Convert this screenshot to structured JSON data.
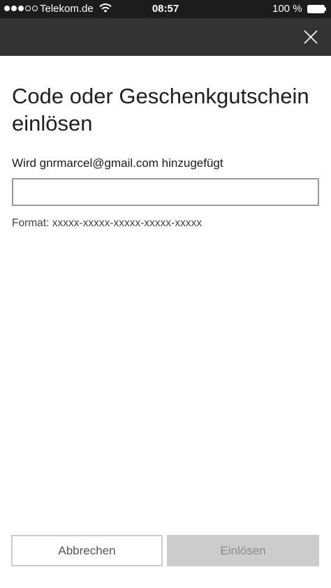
{
  "status_bar": {
    "carrier": "Telekom.de",
    "time": "08:57",
    "battery": "100 %",
    "signal_bars_filled": 3,
    "signal_bars_total": 5
  },
  "header": {
    "close_icon": "close-icon"
  },
  "main": {
    "title": "Code oder Geschenkgutschein einlösen",
    "account_label": "Wird gnrmarcel@gmail.com hinzugefügt",
    "code_input": {
      "value": "",
      "placeholder": ""
    },
    "format_hint": "Format: xxxxx-xxxxx-xxxxx-xxxxx-xxxxx"
  },
  "footer": {
    "cancel_label": "Abbrechen",
    "redeem_label": "Einlösen"
  },
  "colors": {
    "status_bar_bg": "#1c1c1c",
    "header_bg": "#333333",
    "disabled_button_bg": "#cccccc"
  }
}
